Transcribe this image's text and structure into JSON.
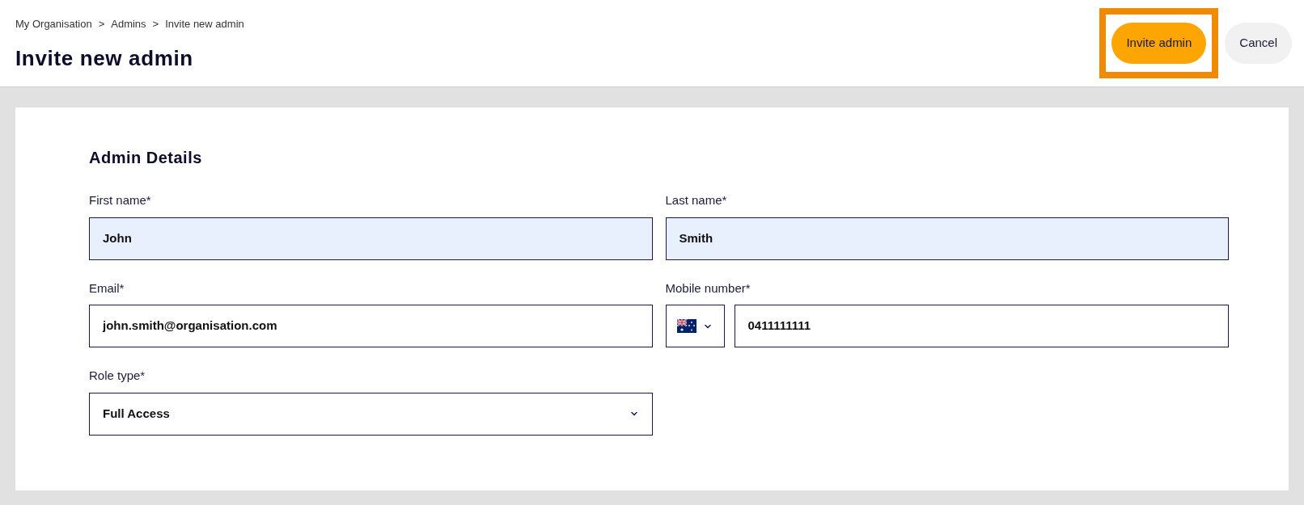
{
  "breadcrumb": [
    "My Organisation",
    "Admins",
    "Invite new admin"
  ],
  "breadcrumb_separator": ">",
  "title": "Invite new admin",
  "actions": [
    {
      "kind": "primary",
      "label": "Invite admin",
      "highlighted": true
    },
    {
      "kind": "secondary",
      "label": "Cancel",
      "highlighted": false
    }
  ],
  "section": {
    "title": "Admin Details",
    "fields": [
      {
        "kind": "text",
        "label": "First name*",
        "value": "John",
        "autofilled": true
      },
      {
        "kind": "text",
        "label": "Last name*",
        "value": "Smith",
        "autofilled": true
      },
      {
        "kind": "text",
        "label": "Email*",
        "value": "john.smith@organisation.com",
        "autofilled": false
      },
      {
        "kind": "phone",
        "label": "Mobile number*",
        "value": "0411111111",
        "autofilled": false
      },
      {
        "kind": "select",
        "label": "Role type*",
        "value": "Full Access",
        "autofilled": false
      }
    ]
  }
}
